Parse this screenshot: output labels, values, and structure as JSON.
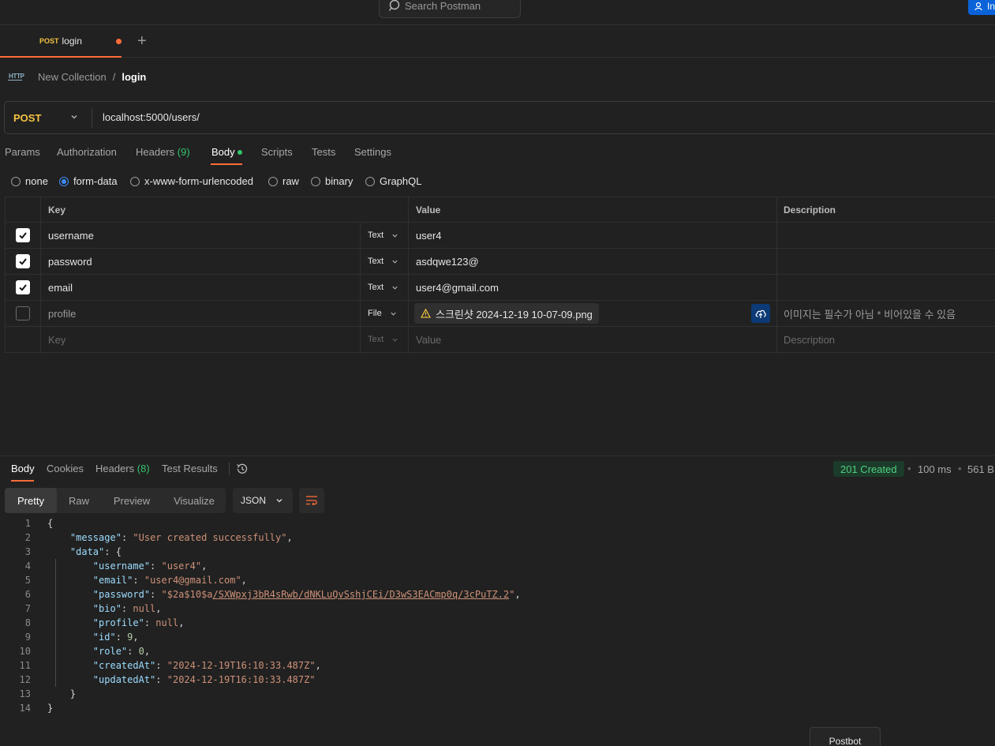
{
  "header": {
    "search_placeholder": "Search Postman",
    "invite_label": "In"
  },
  "tab": {
    "method": "POST",
    "name": "login"
  },
  "breadcrumb": {
    "icon_text": "HTTP",
    "collection": "New Collection",
    "separator": "/",
    "request": "login"
  },
  "request": {
    "method": "POST",
    "url": "localhost:5000/users/"
  },
  "request_tabs": [
    "Params",
    "Authorization",
    "Headers",
    "(9)",
    "Body",
    "Scripts",
    "Tests",
    "Settings"
  ],
  "body_types": [
    "none",
    "form-data",
    "x-www-form-urlencoded",
    "raw",
    "binary",
    "GraphQL"
  ],
  "body_type_selected": "form-data",
  "table": {
    "headers": {
      "key": "Key",
      "value": "Value",
      "description": "Description"
    },
    "rows": [
      {
        "checked": true,
        "key": "username",
        "type": "Text",
        "value": "user4",
        "description": ""
      },
      {
        "checked": true,
        "key": "password",
        "type": "Text",
        "value": "asdqwe123@",
        "description": ""
      },
      {
        "checked": true,
        "key": "email",
        "type": "Text",
        "value": "user4@gmail.com",
        "description": ""
      },
      {
        "checked": false,
        "key": "profile",
        "type": "File",
        "value": "스크린샷 2024-12-19 10-07-09.png",
        "description": "이미지는 필수가 아님 * 비어있을 수 있음"
      }
    ],
    "placeholder": {
      "key": "Key",
      "type": "Text",
      "value": "Value",
      "description": "Description"
    }
  },
  "response": {
    "tabs": [
      "Body",
      "Cookies",
      "Headers",
      "(8)",
      "Test Results"
    ],
    "status": "201 Created",
    "time": "100 ms",
    "size": "561 B",
    "views": [
      "Pretty",
      "Raw",
      "Preview",
      "Visualize"
    ],
    "format": "JSON",
    "line_numbers": [
      "1",
      "2",
      "3",
      "4",
      "5",
      "6",
      "7",
      "8",
      "9",
      "10",
      "11",
      "12",
      "13",
      "14"
    ],
    "json": {
      "message": "User created successfully",
      "username": "user4",
      "email": "user4@gmail.com",
      "password_prefix": "$2a$10$a",
      "password_rest": "/SXWpxj3bR4sRwb/dNKLuQvSshjCEi/D3wS3EACmp0q/3cPuTZ.2",
      "bio": "null",
      "profile": "null",
      "id": "9",
      "role": "0",
      "createdAt": "2024-12-19T16:10:33.487Z",
      "updatedAt": "2024-12-19T16:10:33.487Z"
    }
  },
  "postbot_label": "Postbot"
}
